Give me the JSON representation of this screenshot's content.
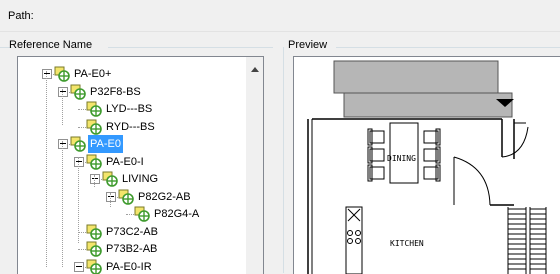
{
  "path": {
    "label": "Path:"
  },
  "reference": {
    "label": "Reference Name",
    "tree": [
      {
        "label": "PA-E0+",
        "depth": 0,
        "toggle": true,
        "selected": false
      },
      {
        "label": "P32F8-BS",
        "depth": 1,
        "toggle": true,
        "selected": false
      },
      {
        "label": "LYD---BS",
        "depth": 2,
        "toggle": false,
        "selected": false
      },
      {
        "label": "RYD---BS",
        "depth": 2,
        "toggle": false,
        "selected": false
      },
      {
        "label": "PA-E0",
        "depth": 1,
        "toggle": true,
        "selected": true
      },
      {
        "label": "PA-E0-I",
        "depth": 2,
        "toggle": true,
        "selected": false
      },
      {
        "label": "LIVING",
        "depth": 3,
        "toggle": true,
        "selected": false
      },
      {
        "label": "P82G2-AB",
        "depth": 4,
        "toggle": true,
        "selected": false
      },
      {
        "label": "P82G4-A",
        "depth": 5,
        "toggle": false,
        "selected": false
      },
      {
        "label": "P73C2-AB",
        "depth": 2,
        "toggle": false,
        "selected": false
      },
      {
        "label": "P73B2-AB",
        "depth": 2,
        "toggle": false,
        "selected": false
      },
      {
        "label": "PA-E0-IR",
        "depth": 2,
        "toggle": true,
        "selected": false
      }
    ]
  },
  "preview": {
    "label": "Preview",
    "room_labels": [
      "DINING",
      "KITCHEN"
    ]
  },
  "colors": {
    "selection": "#3399ff",
    "icon_green": "#3f9b2e",
    "icon_yellow": "#f3e56b"
  }
}
